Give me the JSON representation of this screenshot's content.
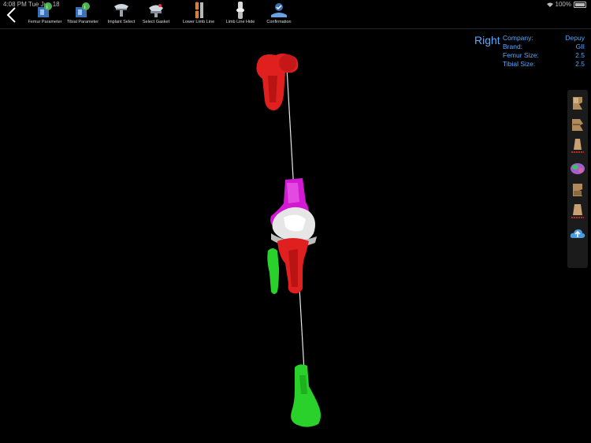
{
  "status": {
    "time": "4:08 PM  Tue Jun 18",
    "battery": "100%"
  },
  "toolbar": {
    "items": [
      {
        "label": "Femur Parameter",
        "icon": "femur-parameter-icon"
      },
      {
        "label": "Tibial Parameter",
        "icon": "tibial-parameter-icon"
      },
      {
        "label": "Implant Select",
        "icon": "implant-select-icon"
      },
      {
        "label": "Select Gasket",
        "icon": "select-gasket-icon"
      },
      {
        "label": "Lower Limb Line",
        "icon": "lower-limb-line-icon"
      },
      {
        "label": "Limb Line Hide",
        "icon": "limb-line-hide-icon"
      },
      {
        "label": "Confirmation",
        "icon": "confirmation-icon"
      }
    ]
  },
  "side": {
    "label": "Right"
  },
  "info": {
    "company_label": "Company:",
    "company_value": "Depuy",
    "brand_label": "Brand:",
    "brand_value": "GII",
    "femur_label": "Femur Size:",
    "femur_value": "2.5",
    "tibial_label": "Tibial  Size:",
    "tibial_value": "2.5"
  },
  "colors": {
    "accent": "#5aa7ff",
    "femur": "#e01f1f",
    "tibia": "#2ad12a",
    "implant": "#d21ad2",
    "insert": "#e6e6e6"
  },
  "side_panel_icons": [
    "bone-view-icon-1",
    "bone-view-icon-2",
    "bone-cut-icon-1",
    "bone-colored-icon",
    "bone-view-icon-3",
    "bone-cut-icon-2",
    "cloud-upload-icon"
  ]
}
